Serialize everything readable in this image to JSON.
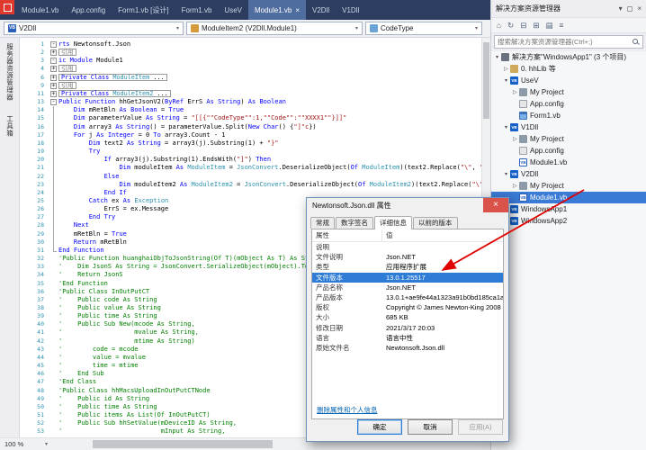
{
  "icons": {
    "close": "×",
    "caret": "▾",
    "tree_collapsed": "▷",
    "tree_expanded": "▾"
  },
  "colors": {
    "selection": "#2f7cd6",
    "keyword": "#0000ff",
    "string": "#a31515",
    "comment": "#008000",
    "type": "#2b91af",
    "tab_active": "#4f6d9e",
    "annotation": "#e00000"
  },
  "tabs": {
    "items": [
      {
        "label": "Module1.vb"
      },
      {
        "label": "App.config"
      },
      {
        "label": "Form1.vb [设计]"
      },
      {
        "label": "Form1.vb"
      },
      {
        "label": "UseV"
      },
      {
        "label": "Module1.vb",
        "active": true
      },
      {
        "label": "V2Dll"
      },
      {
        "label": "V1Dll"
      }
    ]
  },
  "navbar": {
    "project": "V2Dll",
    "type": "ModuleItem2 (V2Dll.Module1)",
    "member": "CodeType"
  },
  "left_strip": {
    "items": [
      "服务器资源管理器",
      "工具箱"
    ]
  },
  "editor": {
    "zoom": "100 %",
    "lines": [
      {
        "n": "1",
        "o": "minus",
        "segs": [
          [
            "k",
            "rts"
          ],
          [
            "p",
            " Newtonsoft.Json"
          ]
        ]
      },
      {
        "n": "2",
        "o": "plus",
        "box": true,
        "segs": [
          [
            "g",
            "引用"
          ]
        ]
      },
      {
        "n": "3",
        "o": "minus",
        "segs": [
          [
            "k",
            "ic"
          ],
          [
            "p",
            " "
          ],
          [
            "k",
            "Module"
          ],
          [
            "p",
            " Module1"
          ]
        ]
      },
      {
        "n": "4",
        "o": "plus",
        "box": true,
        "segs": [
          [
            "g",
            "引用"
          ]
        ]
      },
      {
        "n": "6",
        "o": "plus",
        "box": true,
        "segs": [
          [
            "k",
            "Private"
          ],
          [
            "p",
            " "
          ],
          [
            "k",
            "Class"
          ],
          [
            "p",
            " "
          ],
          [
            "t",
            "ModuleItem"
          ],
          [
            "p",
            " ..."
          ]
        ]
      },
      {
        "n": "9",
        "o": "plus",
        "box": true,
        "segs": [
          [
            "g",
            "引用"
          ]
        ]
      },
      {
        "n": "11",
        "o": "plus",
        "box": true,
        "segs": [
          [
            "k",
            "Private"
          ],
          [
            "p",
            " "
          ],
          [
            "k",
            "Class"
          ],
          [
            "p",
            " "
          ],
          [
            "t",
            "ModuleItem2"
          ],
          [
            "p",
            " ..."
          ]
        ]
      },
      {
        "n": "13",
        "o": "minus",
        "segs": [
          [
            "k",
            "Public"
          ],
          [
            "p",
            " "
          ],
          [
            "k",
            "Function"
          ],
          [
            "p",
            " hhGetJsonV2("
          ],
          [
            "k",
            "ByRef"
          ],
          [
            "p",
            " ErrS "
          ],
          [
            "k",
            "As"
          ],
          [
            "p",
            " "
          ],
          [
            "k",
            "String"
          ],
          [
            "p",
            ") "
          ],
          [
            "k",
            "As"
          ],
          [
            "p",
            " "
          ],
          [
            "k",
            "Boolean"
          ]
        ]
      },
      {
        "n": "14",
        "o": "line",
        "segs": [
          [
            "p",
            "    "
          ],
          [
            "k",
            "Dim"
          ],
          [
            "p",
            " mRetBln "
          ],
          [
            "k",
            "As"
          ],
          [
            "p",
            " "
          ],
          [
            "k",
            "Boolean"
          ],
          [
            "p",
            " = "
          ],
          [
            "k",
            "True"
          ]
        ]
      },
      {
        "n": "15",
        "o": "line",
        "segs": [
          [
            "p",
            "    "
          ],
          [
            "k",
            "Dim"
          ],
          [
            "p",
            " parameterValue "
          ],
          [
            "k",
            "As"
          ],
          [
            "p",
            " "
          ],
          [
            "k",
            "String"
          ],
          [
            "p",
            " = "
          ],
          [
            "s",
            "\"[[{\"\"CodeType\"\":1,\"\"Code\"\":\"\"XXXX1\"\"}]]\""
          ]
        ]
      },
      {
        "n": "16",
        "o": "line",
        "segs": [
          [
            "p",
            "    "
          ],
          [
            "k",
            "Dim"
          ],
          [
            "p",
            " array3 "
          ],
          [
            "k",
            "As"
          ],
          [
            "p",
            " "
          ],
          [
            "k",
            "String"
          ],
          [
            "p",
            "() = parameterValue.Split("
          ],
          [
            "k",
            "New"
          ],
          [
            "p",
            " "
          ],
          [
            "k",
            "Char"
          ],
          [
            "p",
            "() {"
          ],
          [
            "s",
            "\"]\"c"
          ],
          [
            "p",
            "})"
          ]
        ]
      },
      {
        "n": "17",
        "o": "line",
        "segs": [
          [
            "p",
            "    "
          ],
          [
            "k",
            "For"
          ],
          [
            "p",
            " j "
          ],
          [
            "k",
            "As"
          ],
          [
            "p",
            " "
          ],
          [
            "k",
            "Integer"
          ],
          [
            "p",
            " = 0 "
          ],
          [
            "k",
            "To"
          ],
          [
            "p",
            " array3.Count - 1"
          ]
        ]
      },
      {
        "n": "18",
        "o": "line",
        "segs": [
          [
            "p",
            "        "
          ],
          [
            "k",
            "Dim"
          ],
          [
            "p",
            " text2 "
          ],
          [
            "k",
            "As"
          ],
          [
            "p",
            " "
          ],
          [
            "k",
            "String"
          ],
          [
            "p",
            " = array3(j).Substring(1) + "
          ],
          [
            "s",
            "\"}\""
          ]
        ]
      },
      {
        "n": "19",
        "o": "line",
        "segs": [
          [
            "p",
            "        "
          ],
          [
            "k",
            "Try"
          ]
        ]
      },
      {
        "n": "20",
        "o": "line",
        "segs": [
          [
            "p",
            "            "
          ],
          [
            "k",
            "If"
          ],
          [
            "p",
            " array3(j).Substring(1).EndsWith("
          ],
          [
            "s",
            "\"]\""
          ],
          [
            "p",
            ") "
          ],
          [
            "k",
            "Then"
          ]
        ]
      },
      {
        "n": "21",
        "o": "line",
        "segs": [
          [
            "p",
            "                "
          ],
          [
            "k",
            "Dim"
          ],
          [
            "p",
            " moduleItem "
          ],
          [
            "k",
            "As"
          ],
          [
            "p",
            " "
          ],
          [
            "t",
            "ModuleItem"
          ],
          [
            "p",
            " = "
          ],
          [
            "t",
            "JsonConvert"
          ],
          [
            "p",
            ".DeserializeObject("
          ],
          [
            "k",
            "Of"
          ],
          [
            "p",
            " "
          ],
          [
            "t",
            "ModuleItem"
          ],
          [
            "p",
            ")(text2.Replace("
          ],
          [
            "s",
            "\"\\\""
          ],
          [
            "p",
            ", "
          ],
          [
            "s",
            "\"\""
          ],
          [
            "p",
            "))"
          ]
        ]
      },
      {
        "n": "22",
        "o": "line",
        "segs": [
          [
            "p",
            "            "
          ],
          [
            "k",
            "Else"
          ]
        ]
      },
      {
        "n": "23",
        "o": "line",
        "segs": [
          [
            "p",
            "                "
          ],
          [
            "k",
            "Dim"
          ],
          [
            "p",
            " moduleItem2 "
          ],
          [
            "k",
            "As"
          ],
          [
            "p",
            " "
          ],
          [
            "t",
            "ModuleItem2"
          ],
          [
            "p",
            " = "
          ],
          [
            "t",
            "JsonConvert"
          ],
          [
            "p",
            ".DeserializeObject("
          ],
          [
            "k",
            "Of"
          ],
          [
            "p",
            " "
          ],
          [
            "t",
            "ModuleItem2"
          ],
          [
            "p",
            ")(text2.Replace("
          ],
          [
            "s",
            "\"\\\""
          ],
          [
            "p",
            ", "
          ],
          [
            "s",
            "\"\""
          ],
          [
            "p",
            "))"
          ]
        ]
      },
      {
        "n": "24",
        "o": "line",
        "segs": [
          [
            "p",
            "            "
          ],
          [
            "k",
            "End If"
          ]
        ]
      },
      {
        "n": "25",
        "o": "line",
        "segs": [
          [
            "p",
            "        "
          ],
          [
            "k",
            "Catch"
          ],
          [
            "p",
            " ex "
          ],
          [
            "k",
            "As"
          ],
          [
            "p",
            " "
          ],
          [
            "t",
            "Exception"
          ]
        ]
      },
      {
        "n": "26",
        "o": "line",
        "segs": [
          [
            "p",
            "            ErrS = ex.Message"
          ]
        ]
      },
      {
        "n": "27",
        "o": "line",
        "segs": [
          [
            "p",
            "        "
          ],
          [
            "k",
            "End Try"
          ]
        ]
      },
      {
        "n": "28",
        "o": "line",
        "segs": [
          [
            "p",
            "    "
          ],
          [
            "k",
            "Next"
          ]
        ]
      },
      {
        "n": "29",
        "o": "line",
        "segs": [
          [
            "p",
            "    mRetBln = "
          ],
          [
            "k",
            "True"
          ]
        ]
      },
      {
        "n": "30",
        "o": "line",
        "segs": [
          [
            "p",
            "    "
          ],
          [
            "k",
            "Return"
          ],
          [
            "p",
            " mRetBln"
          ]
        ]
      },
      {
        "n": "31",
        "o": "end",
        "segs": [
          [
            "k",
            "End Function"
          ]
        ]
      },
      {
        "n": "32",
        "segs": [
          [
            "c",
            "'Public Function huanghaiObjToJsonString(Of T)(mObject As T) As String"
          ]
        ]
      },
      {
        "n": "33",
        "segs": [
          [
            "c",
            "'    Dim JsonS As String = JsonConvert.SerializeObject(mObject).ToString"
          ]
        ]
      },
      {
        "n": "34",
        "segs": [
          [
            "c",
            "'    Return JsonS"
          ]
        ]
      },
      {
        "n": "35",
        "segs": [
          [
            "c",
            "'End Function"
          ]
        ]
      },
      {
        "n": "36",
        "segs": [
          [
            "c",
            "'Public Class InOutPutCT"
          ]
        ]
      },
      {
        "n": "37",
        "segs": [
          [
            "c",
            "'    Public code As String"
          ]
        ]
      },
      {
        "n": "38",
        "segs": [
          [
            "c",
            "'    Public value As String"
          ]
        ]
      },
      {
        "n": "39",
        "segs": [
          [
            "c",
            "'    Public time As String"
          ]
        ]
      },
      {
        "n": "40",
        "segs": [
          [
            "c",
            "'    Public Sub New(mcode As String,"
          ]
        ]
      },
      {
        "n": "41",
        "segs": [
          [
            "c",
            "'                   mvalue As String,"
          ]
        ]
      },
      {
        "n": "42",
        "segs": [
          [
            "c",
            "'                   mtime As String)"
          ]
        ]
      },
      {
        "n": "43",
        "segs": [
          [
            "c",
            "'        code = mcode"
          ]
        ]
      },
      {
        "n": "44",
        "segs": [
          [
            "c",
            "'        value = mvalue"
          ]
        ]
      },
      {
        "n": "45",
        "segs": [
          [
            "c",
            "'        time = mtime"
          ]
        ]
      },
      {
        "n": "46",
        "segs": [
          [
            "c",
            "'    End Sub"
          ]
        ]
      },
      {
        "n": "47",
        "segs": [
          [
            "c",
            "'End Class"
          ]
        ]
      },
      {
        "n": "48",
        "segs": [
          [
            "c",
            "'Public Class hhMacsUploadInOutPutCTNode"
          ]
        ]
      },
      {
        "n": "49",
        "segs": [
          [
            "c",
            "'    Public id As String"
          ]
        ]
      },
      {
        "n": "50",
        "segs": [
          [
            "c",
            "'    Public time As String"
          ]
        ]
      },
      {
        "n": "51",
        "segs": [
          [
            "c",
            "'    Public items As List(Of InOutPutCT)"
          ]
        ]
      },
      {
        "n": "52",
        "segs": [
          [
            "c",
            "'    Public Sub hhSetValue(mDeviceID As String,"
          ]
        ]
      },
      {
        "n": "53",
        "segs": [
          [
            "c",
            "'                          mInput As String,"
          ]
        ]
      }
    ]
  },
  "solution_explorer": {
    "title": "解决方案资源管理器",
    "search_placeholder": "搜索解决方案资源管理器(Ctrl+;)",
    "header_icons": [
      {
        "name": "chevron-down-icon",
        "glyph": "▾"
      },
      {
        "name": "float-window-icon",
        "glyph": "◻"
      },
      {
        "name": "close-icon",
        "glyph": "×"
      }
    ],
    "toolbar_icons": [
      {
        "name": "home-icon",
        "glyph": "⌂"
      },
      {
        "name": "sync-with-active-document-icon",
        "glyph": "↻"
      },
      {
        "name": "collapse-all-icon",
        "glyph": "⊟"
      },
      {
        "name": "pending-changes-filter-icon",
        "glyph": "⊞"
      },
      {
        "name": "show-all-files-icon",
        "glyph": "▤"
      },
      {
        "name": "properties-icon",
        "glyph": "≡"
      }
    ],
    "items": [
      {
        "label": "解决方案\"WindowsApp1\" (3 个项目)",
        "indent": 0,
        "arrow": "expanded",
        "icon": "solution"
      },
      {
        "label": "0. hhLib 等",
        "indent": 1,
        "arrow": "collapsed",
        "icon": "folder"
      },
      {
        "label": "UseV",
        "indent": 1,
        "arrow": "expanded",
        "icon": "vbproj"
      },
      {
        "label": "My Project",
        "indent": 2,
        "arrow": "collapsed",
        "icon": "myproject"
      },
      {
        "label": "App.config",
        "indent": 2,
        "arrow": "none",
        "icon": "config"
      },
      {
        "label": "Form1.vb",
        "indent": 2,
        "arrow": "none",
        "icon": "form"
      },
      {
        "label": "V1Dll",
        "indent": 1,
        "arrow": "expanded",
        "icon": "vbproj"
      },
      {
        "label": "My Project",
        "indent": 2,
        "arrow": "collapsed",
        "icon": "myproject"
      },
      {
        "label": "App.config",
        "indent": 2,
        "arrow": "none",
        "icon": "config"
      },
      {
        "label": "Module1.vb",
        "indent": 2,
        "arrow": "none",
        "icon": "vbfile"
      },
      {
        "label": "V2Dll",
        "indent": 1,
        "arrow": "expanded",
        "icon": "vbproj"
      },
      {
        "label": "My Project",
        "indent": 2,
        "arrow": "collapsed",
        "icon": "myproject"
      },
      {
        "label": "Module1.vb",
        "indent": 2,
        "arrow": "none",
        "icon": "vbfile",
        "selected": true
      },
      {
        "label": "WindowsApp1",
        "indent": 1,
        "arrow": "collapsed",
        "icon": "vbproj"
      },
      {
        "label": "WindowsApp2",
        "indent": 1,
        "arrow": "collapsed",
        "icon": "vbproj"
      }
    ]
  },
  "dialog": {
    "title": "Newtonsoft.Json.dll 属性",
    "tabs": [
      {
        "label": "常规"
      },
      {
        "label": "数字签名"
      },
      {
        "label": "详细信息",
        "active": true
      },
      {
        "label": "以前的版本"
      }
    ],
    "columns": [
      "属性",
      "值"
    ],
    "rows": [
      {
        "name": "说明",
        "group": true
      },
      {
        "name": "文件说明",
        "value": "Json.NET"
      },
      {
        "name": "类型",
        "value": "应用程序扩展"
      },
      {
        "name": "文件版本",
        "value": "13.0.1.25517",
        "selected": true
      },
      {
        "name": "产品名称",
        "value": "Json.NET"
      },
      {
        "name": "产品版本",
        "value": "13.0.1+ae9fe44a1323a91b0bd185ca1a"
      },
      {
        "name": "版权",
        "value": "Copyright © James Newton-King 2008"
      },
      {
        "name": "大小",
        "value": "685 KB"
      },
      {
        "name": "修改日期",
        "value": "2021/3/17 20:03"
      },
      {
        "name": "语言",
        "value": "语言中性"
      },
      {
        "name": "原始文件名",
        "value": "Newtonsoft.Json.dll"
      }
    ],
    "link": "删除属性和个人信息",
    "buttons": [
      {
        "label": "确定",
        "name": "ok-button",
        "default": true
      },
      {
        "label": "取消",
        "name": "cancel-button"
      },
      {
        "label": "应用(A)",
        "name": "apply-button",
        "disabled": true
      }
    ]
  }
}
